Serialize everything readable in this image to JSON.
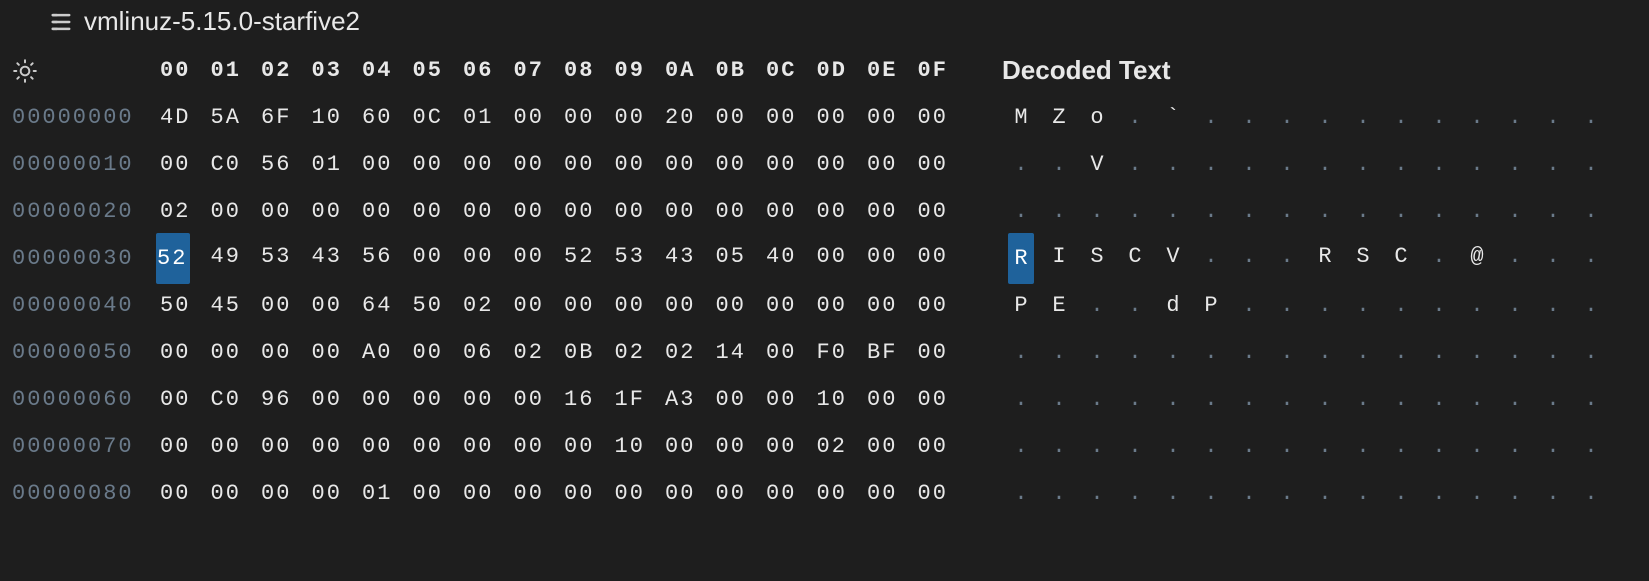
{
  "tab": {
    "title": "vmlinuz-5.15.0-starfive2"
  },
  "headers": {
    "columns": [
      "00",
      "01",
      "02",
      "03",
      "04",
      "05",
      "06",
      "07",
      "08",
      "09",
      "0A",
      "0B",
      "0C",
      "0D",
      "0E",
      "0F"
    ],
    "decoded": "Decoded Text"
  },
  "selection": {
    "row": 3,
    "col": 0
  },
  "rows": [
    {
      "offset": "00000000",
      "hex": [
        "4D",
        "5A",
        "6F",
        "10",
        "60",
        "0C",
        "01",
        "00",
        "00",
        "00",
        "20",
        "00",
        "00",
        "00",
        "00",
        "00"
      ],
      "decoded": [
        "M",
        "Z",
        "o",
        ".",
        "`",
        ".",
        ".",
        ".",
        ".",
        ".",
        ".",
        ".",
        ".",
        ".",
        ".",
        "."
      ]
    },
    {
      "offset": "00000010",
      "hex": [
        "00",
        "C0",
        "56",
        "01",
        "00",
        "00",
        "00",
        "00",
        "00",
        "00",
        "00",
        "00",
        "00",
        "00",
        "00",
        "00"
      ],
      "decoded": [
        ".",
        ".",
        "V",
        ".",
        ".",
        ".",
        ".",
        ".",
        ".",
        ".",
        ".",
        ".",
        ".",
        ".",
        ".",
        "."
      ]
    },
    {
      "offset": "00000020",
      "hex": [
        "02",
        "00",
        "00",
        "00",
        "00",
        "00",
        "00",
        "00",
        "00",
        "00",
        "00",
        "00",
        "00",
        "00",
        "00",
        "00"
      ],
      "decoded": [
        ".",
        ".",
        ".",
        ".",
        ".",
        ".",
        ".",
        ".",
        ".",
        ".",
        ".",
        ".",
        ".",
        ".",
        ".",
        "."
      ]
    },
    {
      "offset": "00000030",
      "hex": [
        "52",
        "49",
        "53",
        "43",
        "56",
        "00",
        "00",
        "00",
        "52",
        "53",
        "43",
        "05",
        "40",
        "00",
        "00",
        "00"
      ],
      "decoded": [
        "R",
        "I",
        "S",
        "C",
        "V",
        ".",
        ".",
        ".",
        "R",
        "S",
        "C",
        ".",
        "@",
        ".",
        ".",
        "."
      ]
    },
    {
      "offset": "00000040",
      "hex": [
        "50",
        "45",
        "00",
        "00",
        "64",
        "50",
        "02",
        "00",
        "00",
        "00",
        "00",
        "00",
        "00",
        "00",
        "00",
        "00"
      ],
      "decoded": [
        "P",
        "E",
        ".",
        ".",
        "d",
        "P",
        ".",
        ".",
        ".",
        ".",
        ".",
        ".",
        ".",
        ".",
        ".",
        "."
      ]
    },
    {
      "offset": "00000050",
      "hex": [
        "00",
        "00",
        "00",
        "00",
        "A0",
        "00",
        "06",
        "02",
        "0B",
        "02",
        "02",
        "14",
        "00",
        "F0",
        "BF",
        "00"
      ],
      "decoded": [
        ".",
        ".",
        ".",
        ".",
        ".",
        ".",
        ".",
        ".",
        ".",
        ".",
        ".",
        ".",
        ".",
        ".",
        ".",
        "."
      ]
    },
    {
      "offset": "00000060",
      "hex": [
        "00",
        "C0",
        "96",
        "00",
        "00",
        "00",
        "00",
        "00",
        "16",
        "1F",
        "A3",
        "00",
        "00",
        "10",
        "00",
        "00"
      ],
      "decoded": [
        ".",
        ".",
        ".",
        ".",
        ".",
        ".",
        ".",
        ".",
        ".",
        ".",
        ".",
        ".",
        ".",
        ".",
        ".",
        "."
      ]
    },
    {
      "offset": "00000070",
      "hex": [
        "00",
        "00",
        "00",
        "00",
        "00",
        "00",
        "00",
        "00",
        "00",
        "10",
        "00",
        "00",
        "00",
        "02",
        "00",
        "00"
      ],
      "decoded": [
        ".",
        ".",
        ".",
        ".",
        ".",
        ".",
        ".",
        ".",
        ".",
        ".",
        ".",
        ".",
        ".",
        ".",
        ".",
        "."
      ]
    },
    {
      "offset": "00000080",
      "hex": [
        "00",
        "00",
        "00",
        "00",
        "01",
        "00",
        "00",
        "00",
        "00",
        "00",
        "00",
        "00",
        "00",
        "00",
        "00",
        "00"
      ],
      "decoded": [
        ".",
        ".",
        ".",
        ".",
        ".",
        ".",
        ".",
        ".",
        ".",
        ".",
        ".",
        ".",
        ".",
        ".",
        ".",
        "."
      ]
    }
  ]
}
